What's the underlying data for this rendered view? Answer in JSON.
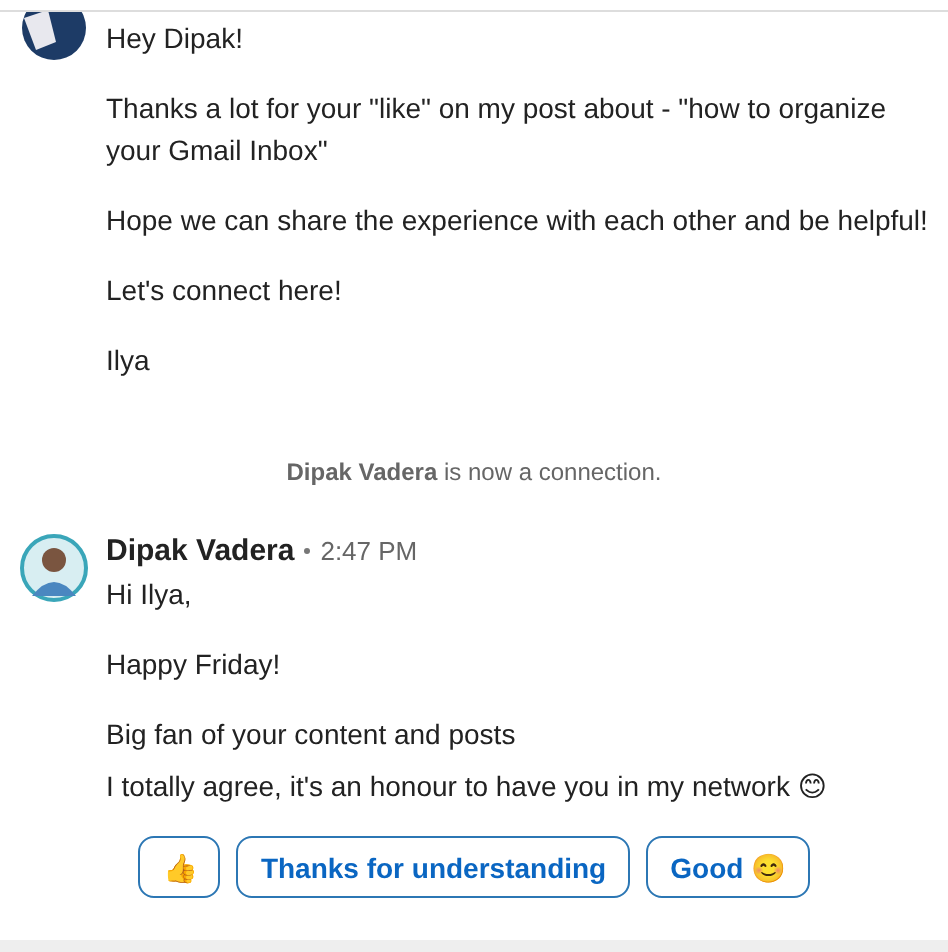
{
  "messages": [
    {
      "paragraphs": [
        [
          "Hey Dipak!"
        ],
        [
          "Thanks a lot for your \"like\" on my post about - \"how to organize your Gmail Inbox\""
        ],
        [
          "Hope we can share the experience with each other and be helpful!"
        ],
        [
          "Let's connect here!"
        ],
        [
          "Ilya"
        ]
      ]
    },
    {
      "kind": "notice",
      "name": "Dipak Vadera",
      "text": "is now a connection."
    },
    {
      "sender": "Dipak Vadera",
      "time": "2:47 PM",
      "paragraphs": [
        [
          "Hi Ilya,"
        ],
        [
          "Happy Friday!"
        ],
        [
          "Big fan of your content and posts",
          "I totally agree, it's an honour to have you in my network 😊"
        ]
      ]
    }
  ],
  "quick_replies": [
    "👍",
    "Thanks for understanding",
    "Good 😊"
  ]
}
